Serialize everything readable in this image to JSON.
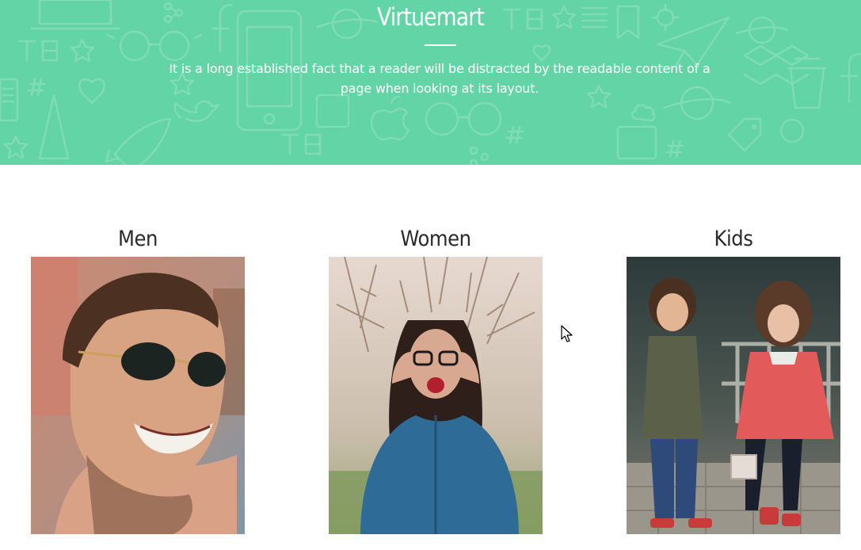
{
  "hero": {
    "title": "Virtuemart",
    "subtitle": "It is a long established fact that a reader will be distracted by the readable content of a page when looking at its layout.",
    "background_color": "#63d4a5",
    "pattern_icons": [
      "book-icon",
      "heart-icon",
      "star-icon",
      "facebook-icon",
      "twitter-icon",
      "rocket-icon",
      "glasses-icon",
      "phone-icon",
      "planet-icon",
      "paper-plane-icon",
      "coffee-cup-icon",
      "hashtag-icon",
      "bookmark-icon",
      "dropbox-icon",
      "apple-icon"
    ]
  },
  "categories": [
    {
      "label": "Men",
      "image": "smiling-man-with-sunglasses-photo"
    },
    {
      "label": "Women",
      "image": "woman-with-glasses-photo"
    },
    {
      "label": "Kids",
      "image": "two-kids-photo"
    }
  ],
  "cursor": {
    "icon": "mouse-pointer-icon"
  }
}
